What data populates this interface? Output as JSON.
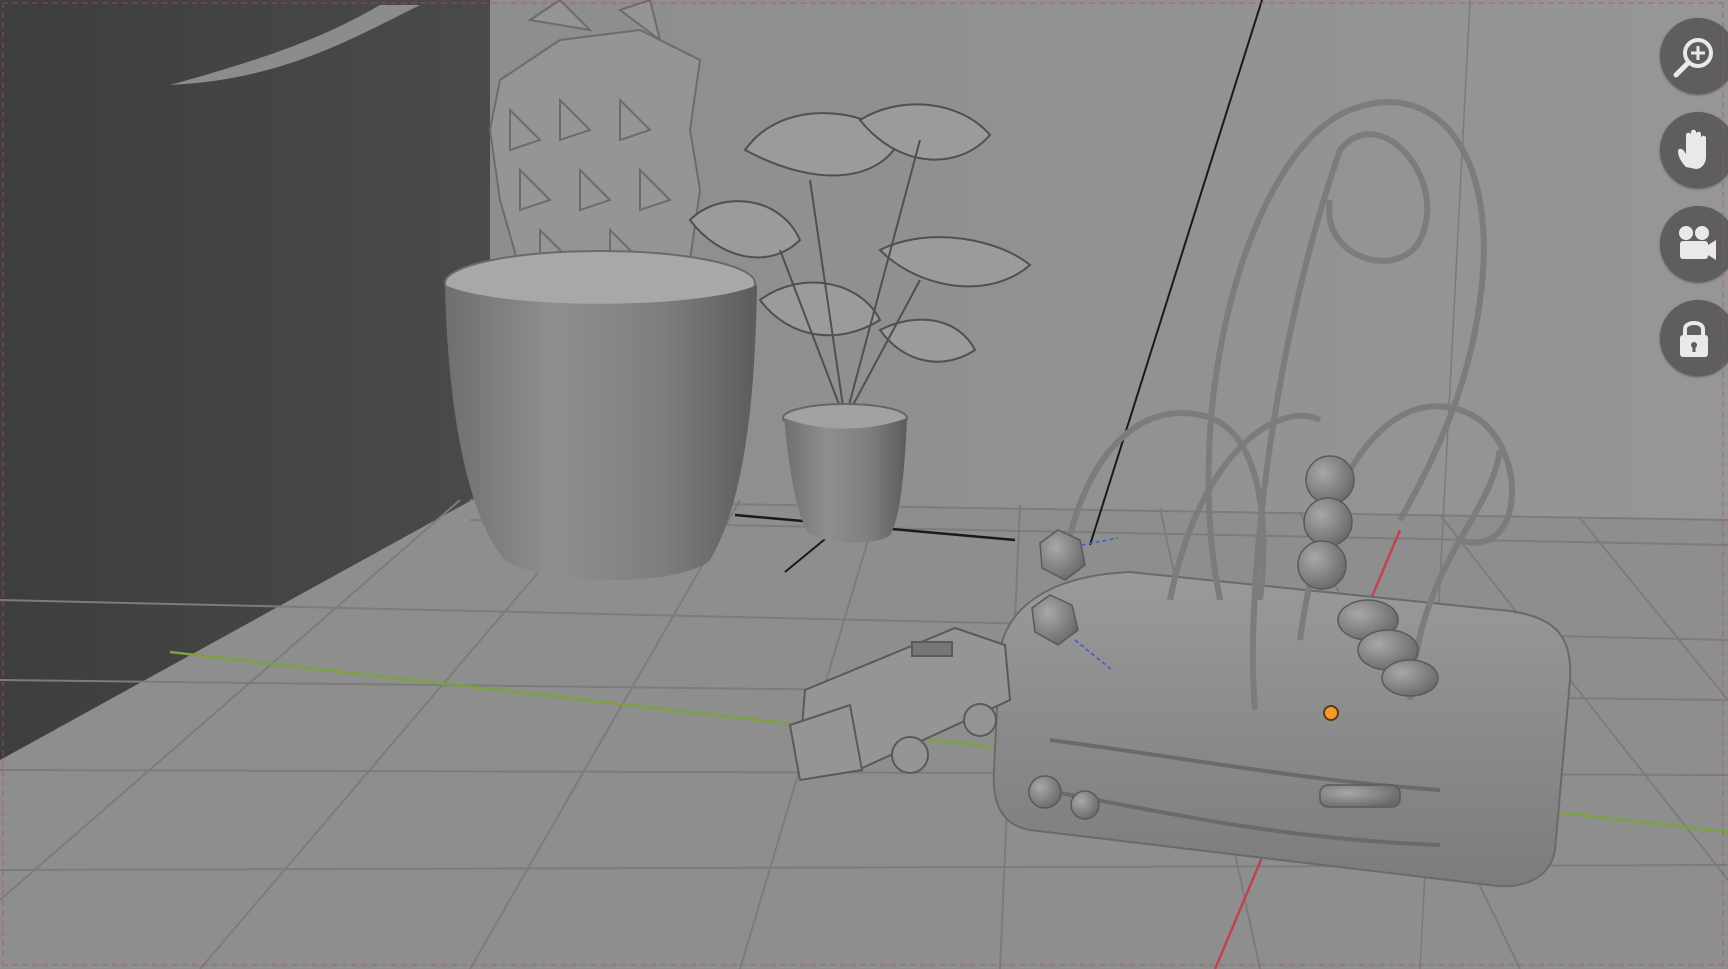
{
  "viewport": {
    "colors": {
      "background": "#8b8b8b",
      "grid_line": "#7a7a7a",
      "x_axis": "#c0434e",
      "y_axis": "#7da041",
      "origin_point": "#f29a2e"
    }
  },
  "navigation_gizmo": {
    "buttons": [
      {
        "name": "zoom-button",
        "icon": "zoom-icon"
      },
      {
        "name": "pan-button",
        "icon": "hand-icon"
      },
      {
        "name": "camera-view-button",
        "icon": "camera-icon"
      },
      {
        "name": "lock-camera-button",
        "icon": "lock-icon"
      }
    ]
  },
  "scene_objects": [
    "large-potted-plant",
    "small-potted-plant",
    "bead-maze-toy",
    "toy-truck",
    "wall",
    "floor-grid"
  ]
}
